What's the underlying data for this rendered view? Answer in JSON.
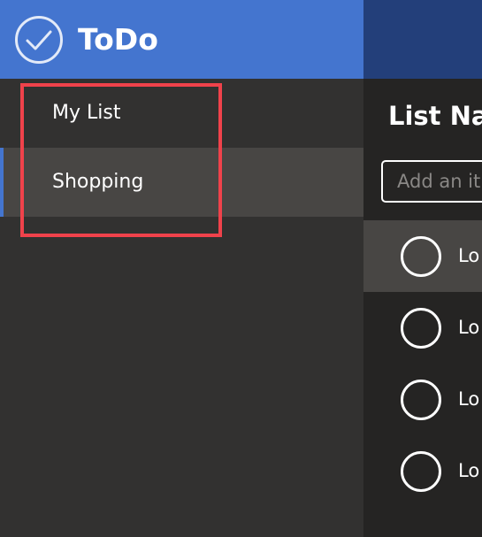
{
  "app": {
    "title": "ToDo",
    "logo_icon": "check-circle-icon"
  },
  "colors": {
    "brand": "#4475cf",
    "header_dark": "#233f7a",
    "highlight": "#f0424b"
  },
  "sidebar": {
    "items": [
      {
        "label": "My List",
        "selected": false
      },
      {
        "label": "Shopping",
        "selected": true
      }
    ]
  },
  "main": {
    "list_name": "List Na",
    "add_input": {
      "placeholder": "Add an it",
      "value": ""
    },
    "todos": [
      {
        "text": "Lo",
        "done": false,
        "hovered": true
      },
      {
        "text": "Lo",
        "done": false,
        "hovered": false
      },
      {
        "text": "Lo",
        "done": false,
        "hovered": false
      },
      {
        "text": "Lo",
        "done": false,
        "hovered": false
      }
    ]
  }
}
